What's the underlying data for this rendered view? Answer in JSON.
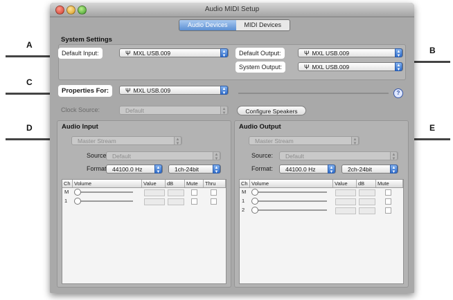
{
  "window": {
    "title": "Audio MIDI Setup"
  },
  "tabs": [
    {
      "label": "Audio Devices",
      "active": true
    },
    {
      "label": "MIDI Devices",
      "active": false
    }
  ],
  "system_settings": {
    "heading": "System Settings",
    "default_input_label": "Default Input:",
    "default_input_value": "MXL USB.009",
    "default_output_label": "Default Output:",
    "default_output_value": "MXL USB.009",
    "system_output_label": "System Output:",
    "system_output_value": "MXL USB.009"
  },
  "properties": {
    "label": "Properties For:",
    "value": "MXL USB.009",
    "help": "?",
    "clock_source_label": "Clock Source:",
    "clock_source_value": "Default",
    "configure_speakers": "Configure Speakers"
  },
  "audio_input": {
    "title": "Audio Input",
    "stream": "Master Stream",
    "source_label": "Source:",
    "source_value": "Default",
    "format_label": "Format:",
    "format_rate": "44100.0 Hz",
    "format_bits": "1ch-24bit",
    "columns": [
      "Ch",
      "Volume",
      "Value",
      "dB",
      "Mute",
      "Thru"
    ],
    "channels": [
      "M",
      "1"
    ]
  },
  "audio_output": {
    "title": "Audio Output",
    "stream": "Master Stream",
    "source_label": "Source:",
    "source_value": "Default",
    "format_label": "Format:",
    "format_rate": "44100.0 Hz",
    "format_bits": "2ch-24bit",
    "columns": [
      "Ch",
      "Volume",
      "Value",
      "dB",
      "Mute"
    ],
    "channels": [
      "M",
      "1",
      "2"
    ]
  },
  "callouts": [
    "A",
    "B",
    "C",
    "D",
    "E"
  ],
  "icons": {
    "usb": "usb-icon",
    "popup": "updown-arrows-icon",
    "help": "help-icon"
  },
  "colors": {
    "accent": "#4f86d6",
    "window": "#a9a9a9"
  }
}
